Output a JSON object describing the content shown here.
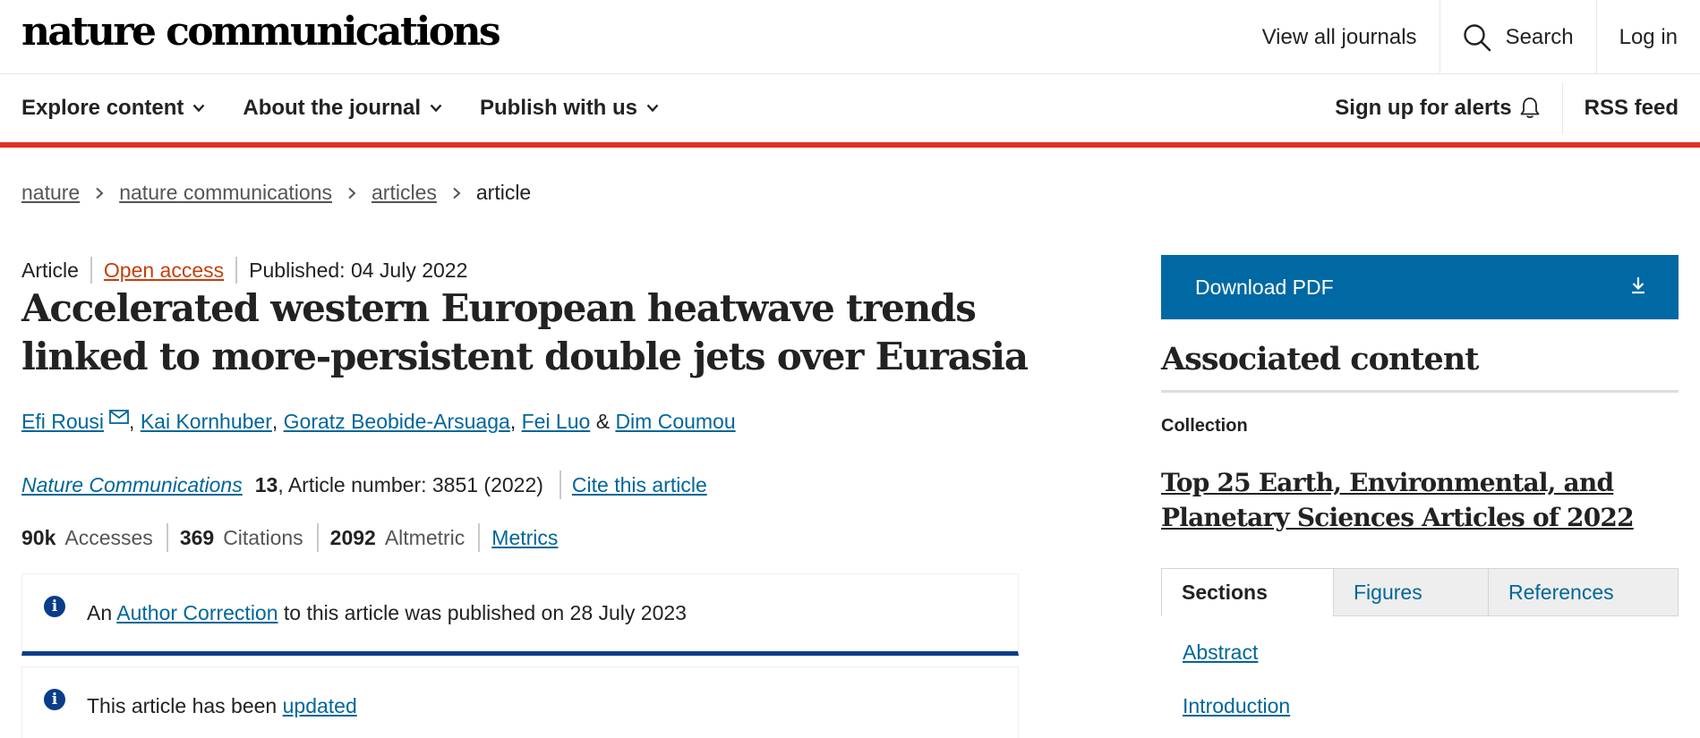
{
  "header": {
    "logo": "nature communications",
    "view_all_journals": "View all journals",
    "search": "Search",
    "login": "Log in"
  },
  "nav": {
    "explore": "Explore content",
    "about": "About the journal",
    "publish": "Publish with us",
    "alerts": "Sign up for alerts",
    "rss": "RSS feed"
  },
  "breadcrumb": [
    "nature",
    "nature communications",
    "articles",
    "article"
  ],
  "article": {
    "type": "Article",
    "access": "Open access",
    "published": "Published: 04 July 2022",
    "title": "Accelerated western European heatwave trends linked to more-persistent double jets over Eurasia",
    "authors": [
      "Efi Rousi",
      "Kai Kornhuber",
      "Goratz Beobide-Arsuaga",
      "Fei Luo",
      "Dim Coumou"
    ],
    "author_sep": ", ",
    "author_amp": " & ",
    "journal_name": "Nature Communications",
    "volume": "13",
    "article_number": ", Article number: 3851 (2022)",
    "cite": "Cite this article",
    "accesses_value": "90k",
    "accesses_label": "Accesses",
    "citations_value": "369",
    "citations_label": "Citations",
    "altmetric_value": "2092",
    "altmetric_label": "Altmetric",
    "metrics_link": "Metrics"
  },
  "notices": {
    "correction_pre": "An ",
    "correction_link": "Author Correction",
    "correction_post": " to this article was published on 28 July 2023",
    "updated_pre": "This article has been ",
    "updated_link": "updated"
  },
  "sidebar": {
    "download": "Download PDF",
    "associated": "Associated content",
    "collection_label": "Collection",
    "collection_title": "Top 25 Earth, Environmental, and Planetary Sciences Articles of 2022",
    "tabs": [
      "Sections",
      "Figures",
      "References"
    ],
    "sections": [
      "Abstract",
      "Introduction"
    ]
  }
}
